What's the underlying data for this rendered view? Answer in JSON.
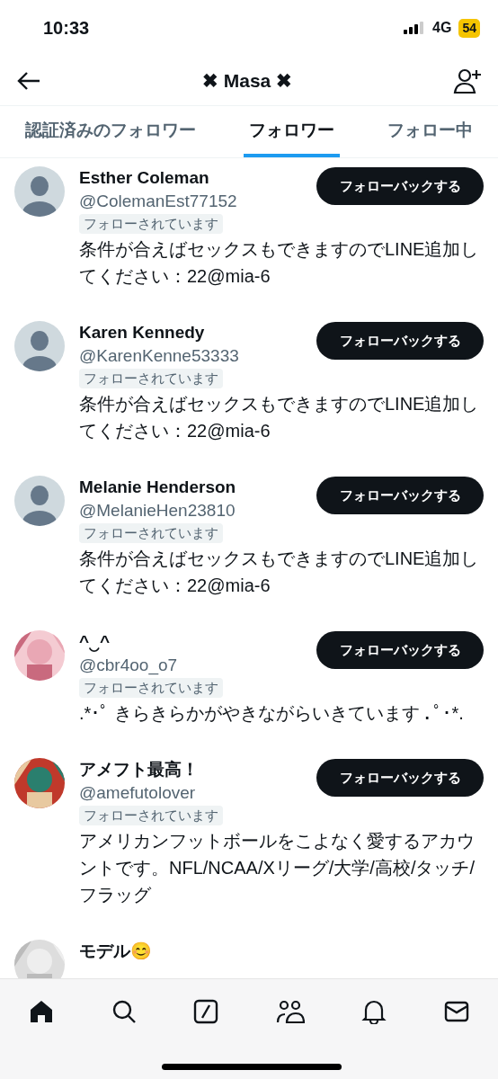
{
  "status_bar": {
    "time": "10:33",
    "network": "4G",
    "battery": "54"
  },
  "header": {
    "title": "✖ Masa ✖"
  },
  "tabs": [
    {
      "label": "認証済みのフォロワー",
      "selected": false
    },
    {
      "label": "フォロワー",
      "selected": true
    },
    {
      "label": "フォロー中",
      "selected": false
    }
  ],
  "users": [
    {
      "name": "Esther Coleman",
      "handle": "@ColemanEst77152",
      "badge": "フォローされています",
      "bio": "条件が合えばセックスもできますのでLINE追加してください：22@mia-6",
      "button": "フォローバックする",
      "avatar": {
        "kind": "default"
      }
    },
    {
      "name": "Karen Kennedy",
      "handle": "@KarenKenne53333",
      "badge": "フォローされています",
      "bio": "条件が合えばセックスもできますのでLINE追加してください：22@mia-6",
      "button": "フォローバックする",
      "avatar": {
        "kind": "default"
      }
    },
    {
      "name": "Melanie Henderson",
      "handle": "@MelanieHen23810",
      "badge": "フォローされています",
      "bio": "条件が合えばセックスもできますのでLINE追加してください：22@mia-6",
      "button": "フォローバックする",
      "avatar": {
        "kind": "default"
      }
    },
    {
      "name": "^‿^",
      "handle": "@cbr4oo_o7",
      "badge": "フォローされています",
      "bio": ".*･ﾟ きらきらかがやきながらいきています .ﾟ･*.",
      "button": "フォローバックする"
    },
    {
      "name": "アメフト最高！",
      "handle": "@amefutolover",
      "badge": "フォローされています",
      "bio": "アメリカンフットボールをこよなく愛するアカウントです。NFL/NCAA/Xリーグ/大学/高校/タッチ/フラッグ",
      "button": "フォローバックする"
    },
    {
      "name": "モデル😊"
    }
  ]
}
